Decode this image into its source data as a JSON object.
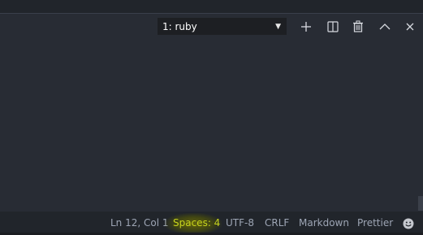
{
  "terminal": {
    "selected_label": "1: ruby"
  },
  "toolbar": {
    "icons": [
      "plus-icon",
      "split-icon",
      "trash-icon",
      "chevron-up-icon",
      "close-icon"
    ]
  },
  "status_bar": {
    "cursor_position": "Ln 12, Col 1",
    "indentation": "Spaces: 4",
    "encoding": "UTF-8",
    "line_ending": "CRLF",
    "language": "Markdown",
    "formatter": "Prettier",
    "feedback_icon": "smiley-icon",
    "indentation_highlight_color": "#c7d41d"
  },
  "colors": {
    "background": "#282c34",
    "status_bar_bg": "#21252b",
    "status_text": "#9da5b4"
  }
}
